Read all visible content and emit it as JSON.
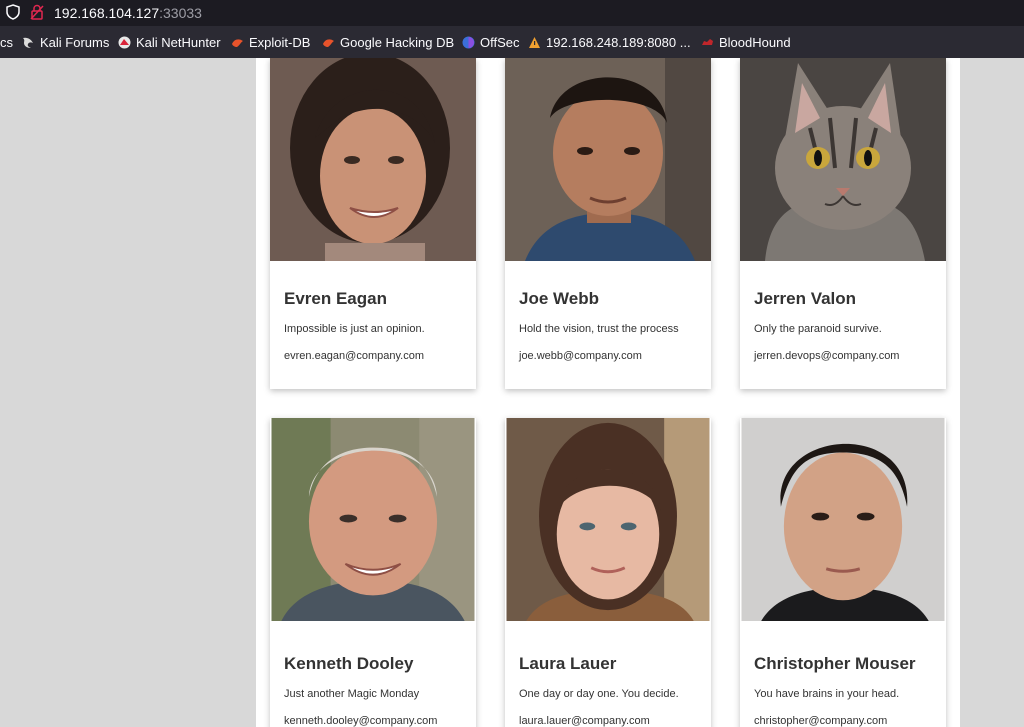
{
  "browser": {
    "url_host": "192.168.104.127",
    "url_port": ":33033"
  },
  "bookmarks": [
    {
      "label": "cs",
      "icon": "folder-icon"
    },
    {
      "label": "Kali Forums",
      "icon": "kali-dragon-icon"
    },
    {
      "label": "Kali NetHunter",
      "icon": "nethunter-icon"
    },
    {
      "label": "Exploit-DB",
      "icon": "exploit-db-icon"
    },
    {
      "label": "Google Hacking DB",
      "icon": "ghdb-icon"
    },
    {
      "label": "OffSec",
      "icon": "offsec-icon"
    },
    {
      "label": "192.168.248.189:8080 ...",
      "icon": "warning-icon"
    },
    {
      "label": "BloodHound",
      "icon": "bloodhound-icon"
    }
  ],
  "team": [
    {
      "name": "Evren Eagan",
      "quote": "Impossible is just an opinion.",
      "email": "evren.eagan@company.com"
    },
    {
      "name": "Joe Webb",
      "quote": "Hold the vision, trust the process",
      "email": "joe.webb@company.com"
    },
    {
      "name": "Jerren Valon",
      "quote": "Only the paranoid survive.",
      "email": "jerren.devops@company.com"
    },
    {
      "name": "Kenneth Dooley",
      "quote": "Just another Magic Monday",
      "email": "kenneth.dooley@company.com"
    },
    {
      "name": "Laura Lauer",
      "quote": "One day or day one. You decide.",
      "email": "laura.lauer@company.com"
    },
    {
      "name": "Christopher Mouser",
      "quote": "You have brains in your head.",
      "email": "christopher@company.com"
    }
  ]
}
